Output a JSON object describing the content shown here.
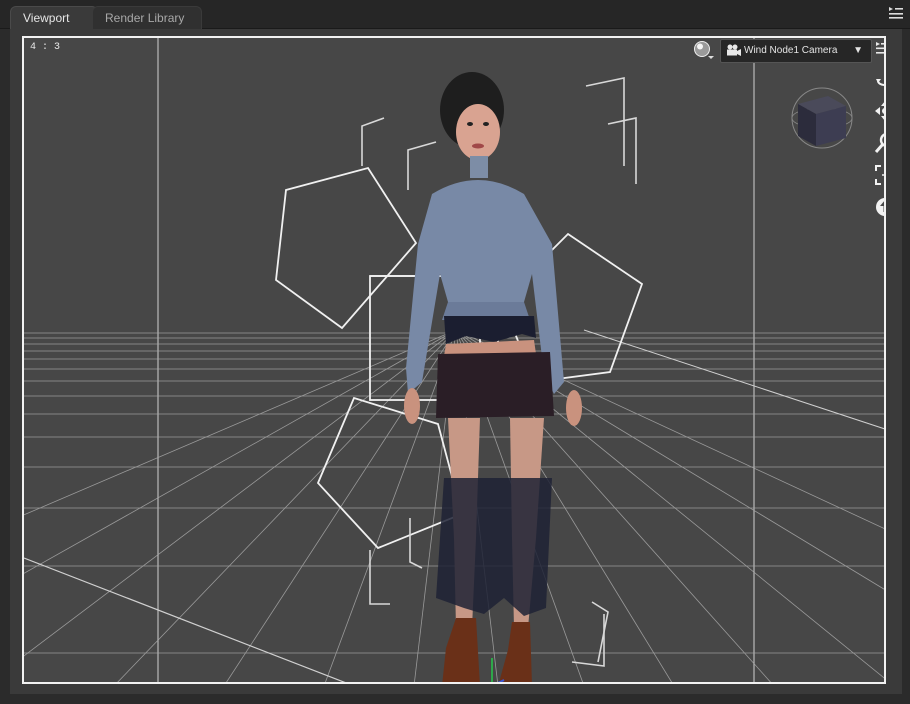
{
  "tabs": {
    "viewport_label": "Viewport",
    "render_library_label": "Render Library"
  },
  "viewport": {
    "aspect_ratio": "4 : 3",
    "camera_label": "Wind Node1 Camera",
    "camera_caret": "▼"
  },
  "icons": {
    "panel_menu": "panel-menu-icon",
    "shading": "sphere-shading-icon",
    "camera": "video-camera-icon",
    "viewport_menu": "list-menu-icon",
    "orbit": "orbit-icon",
    "pan": "pan-icon",
    "zoom": "zoom-icon",
    "frame": "frame-icon",
    "reset": "reset-view-icon"
  },
  "colors": {
    "viewport_bg": "#4a4a4a",
    "frame_border": "#f2f2f2",
    "grid_line": "#bdbdbd"
  }
}
